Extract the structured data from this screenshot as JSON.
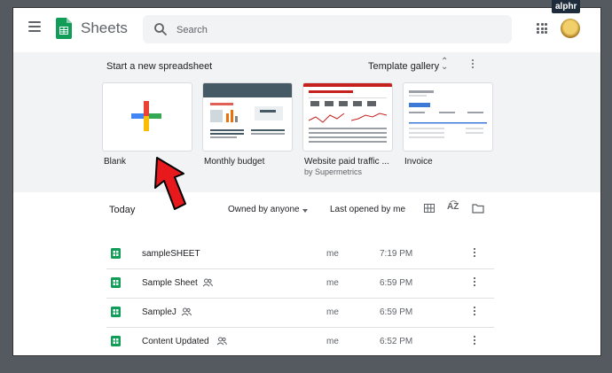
{
  "badge": "alphr",
  "header": {
    "app_title": "Sheets",
    "search_placeholder": "Search"
  },
  "templates": {
    "heading": "Start a new spreadsheet",
    "gallery_label": "Template gallery",
    "cards": [
      {
        "label": "Blank",
        "sub": ""
      },
      {
        "label": "Monthly budget",
        "sub": ""
      },
      {
        "label": "Website paid traffic ...",
        "sub": "by Supermetrics"
      },
      {
        "label": "Invoice",
        "sub": ""
      }
    ]
  },
  "recent": {
    "section_label": "Today",
    "owner_filter": "Owned by anyone",
    "sort_label": "Last opened by me",
    "files": [
      {
        "name": "sampleSHEET",
        "shared": false,
        "owner": "me",
        "time": "7:19 PM"
      },
      {
        "name": "Sample Sheet",
        "shared": true,
        "owner": "me",
        "time": "6:59 PM"
      },
      {
        "name": "SampleJ",
        "shared": true,
        "owner": "me",
        "time": "6:59 PM"
      },
      {
        "name": "Content Updated",
        "shared": true,
        "owner": "me",
        "time": "6:52 PM"
      }
    ]
  },
  "colors": {
    "sheets_green": "#0f9d58",
    "plus_blue": "#4285f4",
    "plus_red": "#ea4335",
    "plus_yellow": "#fbbc04",
    "plus_green": "#34a853",
    "arrow_red": "#e8191c"
  }
}
